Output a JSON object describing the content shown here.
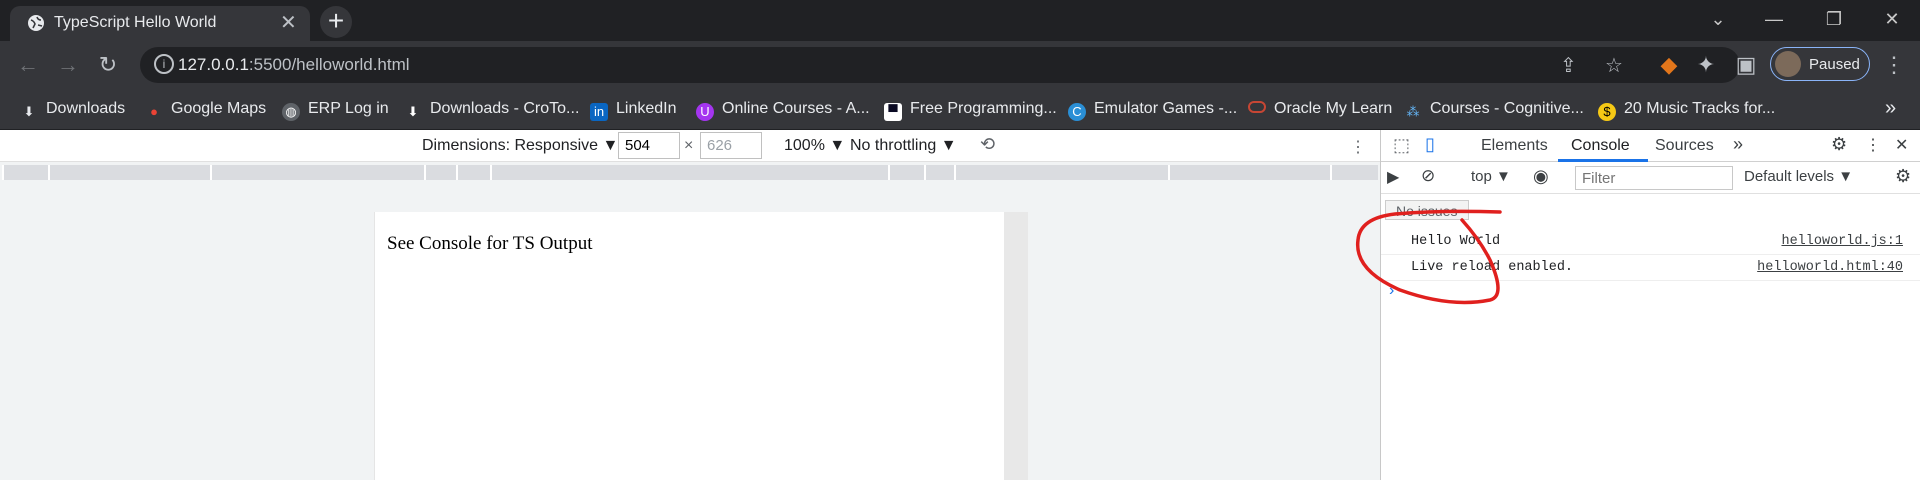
{
  "tab": {
    "title": "TypeScript Hello World",
    "close": "✕",
    "new_tab": "+"
  },
  "window": {
    "minimize": "—",
    "restore": "❐",
    "close": "✕",
    "tab_search": "⌄"
  },
  "toolbar": {
    "url_host": "127.0.0.1",
    "url_rest": ":5500/helloworld.html",
    "profile_label": "Paused"
  },
  "bookmarks": [
    {
      "label": "Downloads",
      "icon": "download-icon",
      "color": "#5f6368"
    },
    {
      "label": "Google Maps",
      "icon": "maps-icon",
      "color": "#34a853"
    },
    {
      "label": "ERP Log in",
      "icon": "globe-icon",
      "color": "#5f6368"
    },
    {
      "label": "Downloads - CroTo...",
      "icon": "download-icon",
      "color": "#5f6368"
    },
    {
      "label": "LinkedIn",
      "icon": "linkedin-icon",
      "color": "#0a66c2"
    },
    {
      "label": "Online Courses - A...",
      "icon": "udemy-icon",
      "color": "#a435f0"
    },
    {
      "label": "Free Programming...",
      "icon": "fcc-icon",
      "color": "#0a0a23"
    },
    {
      "label": "Emulator Games -...",
      "icon": "emulator-icon",
      "color": "#2a8fd6"
    },
    {
      "label": "Oracle My Learn",
      "icon": "oracle-icon",
      "color": "#c74634"
    },
    {
      "label": "Courses - Cognitive...",
      "icon": "cognitive-icon",
      "color": "#1e88e5"
    },
    {
      "label": "20 Music Tracks for...",
      "icon": "dollar-icon",
      "color": "#f6c915"
    }
  ],
  "device_toolbar": {
    "dimensions": "Dimensions: Responsive",
    "width": "504",
    "times": "×",
    "height": "626",
    "zoom": "100%",
    "throttling": "No throttling"
  },
  "page": {
    "text": "See Console for TS Output"
  },
  "devtools": {
    "tabs": [
      "Elements",
      "Console",
      "Sources"
    ],
    "context": "top",
    "filter_placeholder": "Filter",
    "levels": "Default levels",
    "issues": "No issues",
    "logs": [
      {
        "message": "Hello World",
        "source": "helloworld.js:1"
      },
      {
        "message": "Live reload enabled.",
        "source": "helloworld.html:40"
      }
    ],
    "prompt": "›"
  },
  "colors": {
    "accent": "#1a73e8",
    "annotation": "#e0201e"
  }
}
